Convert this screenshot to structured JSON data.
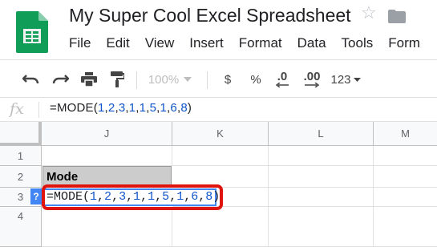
{
  "document": {
    "title": "My Super Cool Excel Spreadsheet"
  },
  "menu": [
    "File",
    "Edit",
    "View",
    "Insert",
    "Format",
    "Data",
    "Tools",
    "Form"
  ],
  "toolbar": {
    "zoom": "100%",
    "currency": "$",
    "percent": "%",
    "decrease_decimal": ".0",
    "increase_decimal": ".00",
    "more_formats": "123"
  },
  "formula_bar": {
    "fx": "fx",
    "formula": "=MODE(1,2,3,1,1,5,1,6,8)"
  },
  "grid": {
    "columns": [
      "J",
      "K",
      "L",
      "M"
    ],
    "rows": [
      "1",
      "2",
      "3",
      "4"
    ],
    "cells": {
      "J2": "Mode",
      "J3": "=MODE(1,2,3,1,1,5,1,6,8)"
    },
    "help_badge": "?"
  },
  "colors": {
    "sheets_green": "#0f9d58",
    "number_blue": "#1155cc",
    "selection_blue": "#4285f4",
    "annotation_red": "#e0140f",
    "header_cell_gray": "#cccccc"
  },
  "icons": [
    "sheets-logo-icon",
    "star-icon",
    "folder-icon",
    "undo-icon",
    "redo-icon",
    "print-icon",
    "paint-format-icon",
    "dropdown-caret-icon",
    "help-icon"
  ]
}
